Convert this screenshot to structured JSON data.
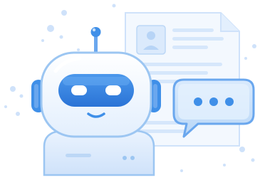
{
  "illustration": {
    "subject": "chatbot-robot-with-document-and-chat-bubble",
    "icons": [
      "robot-icon",
      "document-icon",
      "chat-bubble-icon",
      "user-card-icon"
    ],
    "colors": {
      "primary": "#3f8fe8",
      "primary_dark": "#2a73d6",
      "light": "#d4e6fb",
      "lighter": "#eaf3fe",
      "outline": "#9cc6f2",
      "visor": "#2f7fe0",
      "white": "#ffffff"
    }
  }
}
